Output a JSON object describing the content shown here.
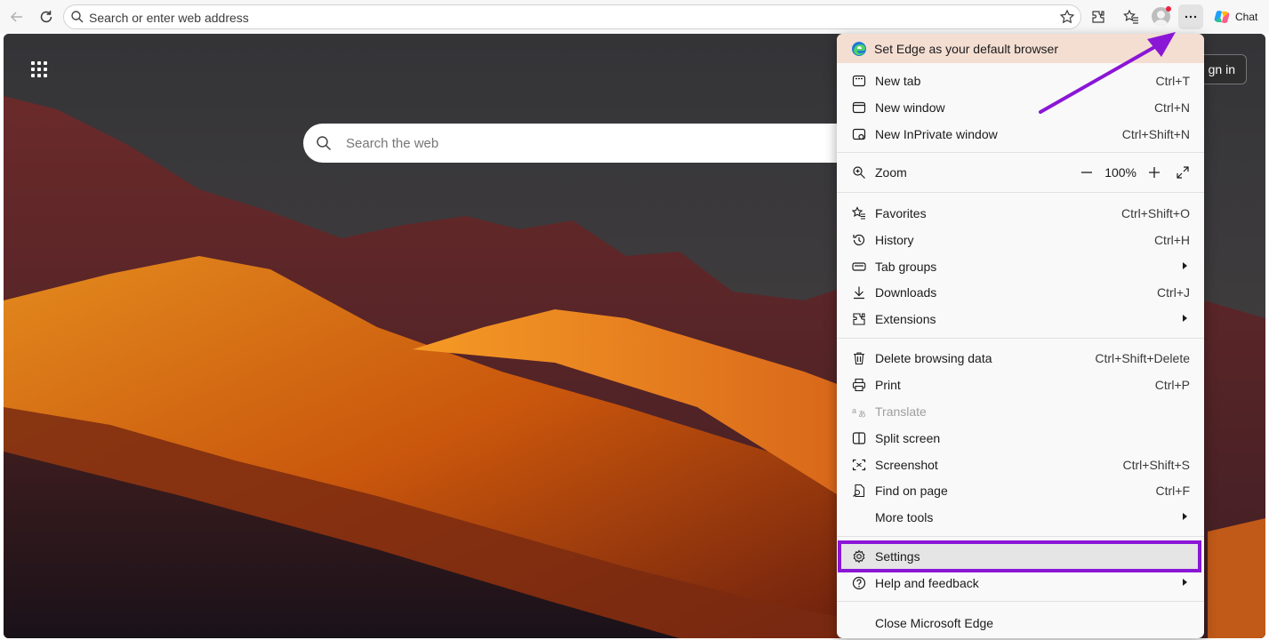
{
  "toolbar": {
    "address_placeholder": "Search or enter web address",
    "chat_label": "Chat",
    "icons": [
      "back-arrow-icon",
      "refresh-icon",
      "search-icon",
      "favorite-star-icon",
      "extensions-icon",
      "favorites-icon",
      "profile-icon",
      "more-icon",
      "copilot-icon"
    ]
  },
  "page": {
    "search_placeholder": "Search the web",
    "signin_label": "gn in"
  },
  "menu": {
    "banner": "Set Edge as your default browser",
    "items": {
      "new_tab": {
        "label": "New tab",
        "shortcut": "Ctrl+T"
      },
      "new_window": {
        "label": "New window",
        "shortcut": "Ctrl+N"
      },
      "new_inprivate": {
        "label": "New InPrivate window",
        "shortcut": "Ctrl+Shift+N"
      },
      "zoom": {
        "label": "Zoom",
        "value": "100%"
      },
      "favorites": {
        "label": "Favorites",
        "shortcut": "Ctrl+Shift+O"
      },
      "history": {
        "label": "History",
        "shortcut": "Ctrl+H"
      },
      "tab_groups": {
        "label": "Tab groups"
      },
      "downloads": {
        "label": "Downloads",
        "shortcut": "Ctrl+J"
      },
      "extensions": {
        "label": "Extensions"
      },
      "delete_data": {
        "label": "Delete browsing data",
        "shortcut": "Ctrl+Shift+Delete"
      },
      "print": {
        "label": "Print",
        "shortcut": "Ctrl+P"
      },
      "translate": {
        "label": "Translate"
      },
      "split_screen": {
        "label": "Split screen"
      },
      "screenshot": {
        "label": "Screenshot",
        "shortcut": "Ctrl+Shift+S"
      },
      "find_on_page": {
        "label": "Find on page",
        "shortcut": "Ctrl+F"
      },
      "more_tools": {
        "label": "More tools"
      },
      "settings": {
        "label": "Settings"
      },
      "help": {
        "label": "Help and feedback"
      },
      "close_edge": {
        "label": "Close Microsoft Edge"
      }
    }
  },
  "colors": {
    "highlight": "#8a16d6",
    "banner_bg": "#f4ded2"
  }
}
